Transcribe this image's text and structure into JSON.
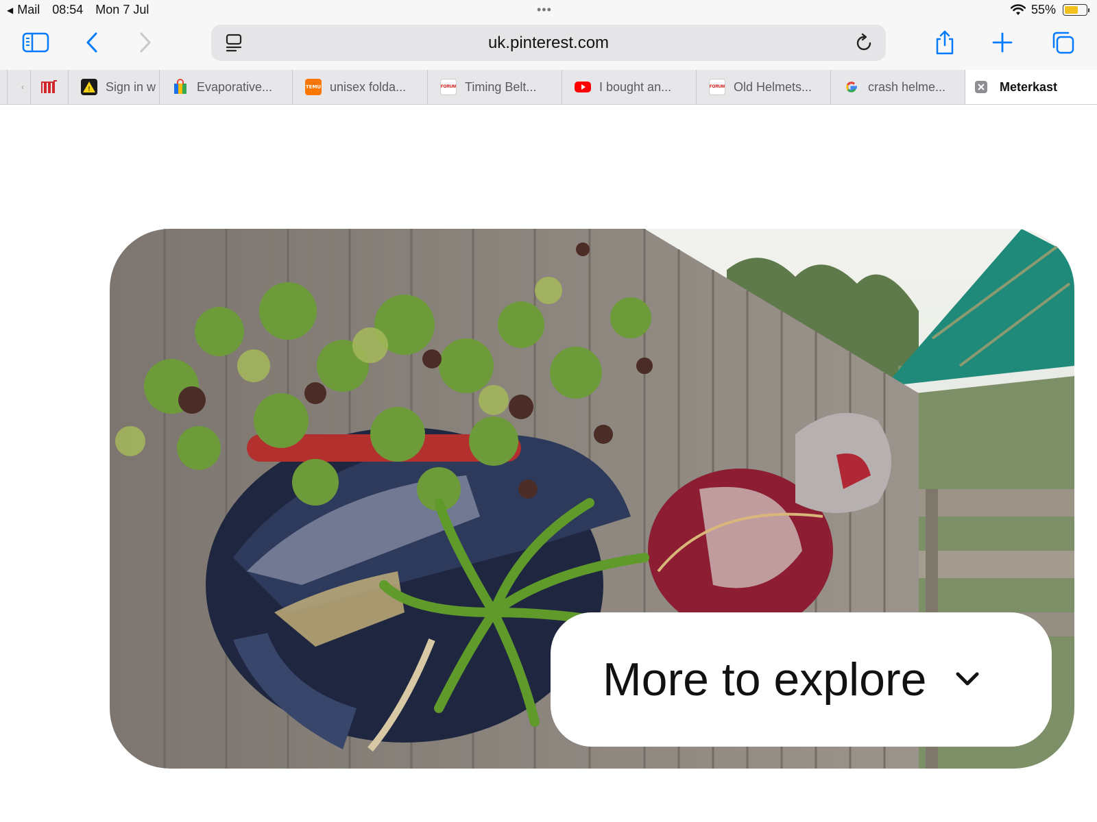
{
  "status_bar": {
    "back_app": "Mail",
    "time": "08:54",
    "date": "Mon 7 Jul",
    "battery": "55%",
    "battery_level": 0.55
  },
  "toolbar": {
    "url": "uk.pinterest.com"
  },
  "tabs": [
    {
      "label": "Sign in w",
      "icon": "warning-sign-icon"
    },
    {
      "label": "Evaporative...",
      "icon": "shopping-bag-icon"
    },
    {
      "label": "unisex folda...",
      "icon": "temu-icon"
    },
    {
      "label": "Timing Belt...",
      "icon": "forum-icon"
    },
    {
      "label": "I bought an...",
      "icon": "youtube-icon"
    },
    {
      "label": "Old Helmets...",
      "icon": "forum-icon"
    },
    {
      "label": "crash helme...",
      "icon": "google-icon"
    },
    {
      "label": "Meterkast",
      "icon": "close-tab-icon",
      "active": true
    }
  ],
  "pin": {
    "explore_label": "More to explore"
  },
  "colors": {
    "accent": "#007aff",
    "tab_bg": "#e7e7e9",
    "toolbar_bg": "#f7f7f7"
  }
}
